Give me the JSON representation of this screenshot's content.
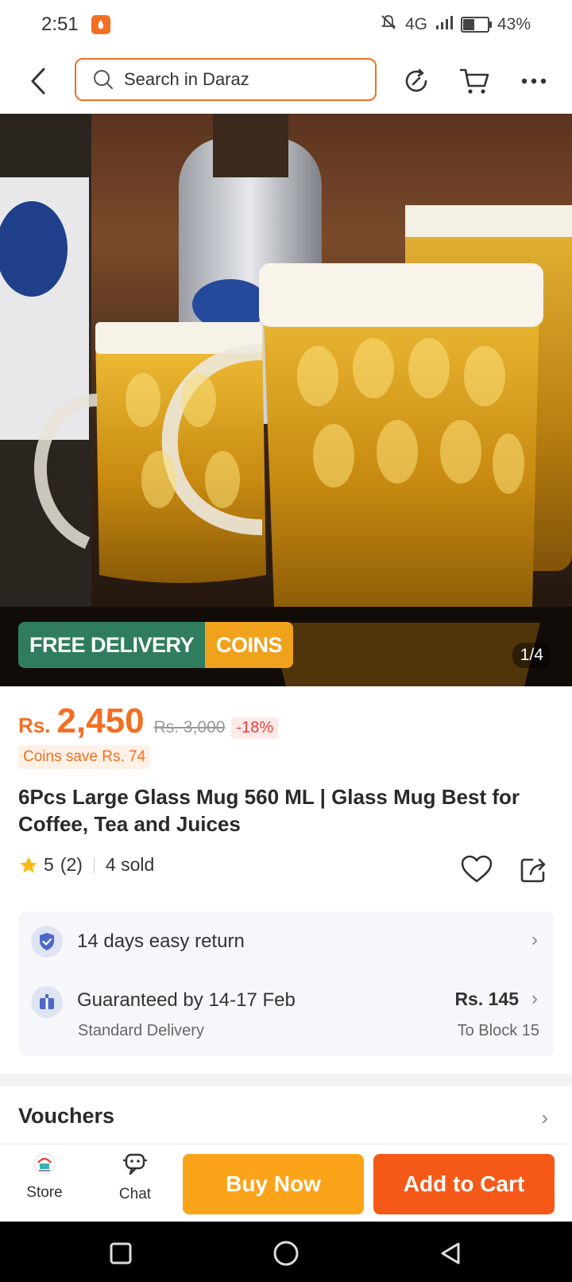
{
  "status_bar": {
    "time": "2:51",
    "network": "4G",
    "battery": "43%",
    "battery_level": 0.43
  },
  "header": {
    "search_placeholder": "Search in Daraz",
    "icons": [
      "back-icon",
      "search-icon",
      "refresh-icon",
      "cart-icon",
      "more-icon"
    ]
  },
  "gallery": {
    "badge_free": "FREE DELIVERY",
    "badge_coins": "COINS",
    "counter": "1/4"
  },
  "price": {
    "currency": "Rs.",
    "current": "2,450",
    "original": "Rs. 3,000",
    "discount": "-18%",
    "coins_save": "Coins save Rs. 74"
  },
  "product": {
    "title": "6Pcs Large Glass Mug 560 ML | Glass Mug Best for Coffee, Tea and Juices",
    "rating": "5",
    "reviews": "(2)",
    "sold": "4 sold"
  },
  "services": {
    "return_text": "14 days easy return",
    "delivery_text": "Guaranteed by 14-17 Feb",
    "delivery_sub": "Standard Delivery",
    "delivery_fee": "Rs. 145",
    "delivery_dest": "To Block 15"
  },
  "vouchers": {
    "label": "Vouchers"
  },
  "bottom_bar": {
    "store_label": "Store",
    "chat_label": "Chat",
    "buy_now": "Buy Now",
    "add_to_cart": "Add to Cart"
  },
  "colors": {
    "brand_orange": "#f36f21",
    "buy_now": "#fba41a",
    "add_to_cart": "#f55918",
    "free_delivery": "#2f7c5e",
    "coins": "#f0a21c"
  }
}
